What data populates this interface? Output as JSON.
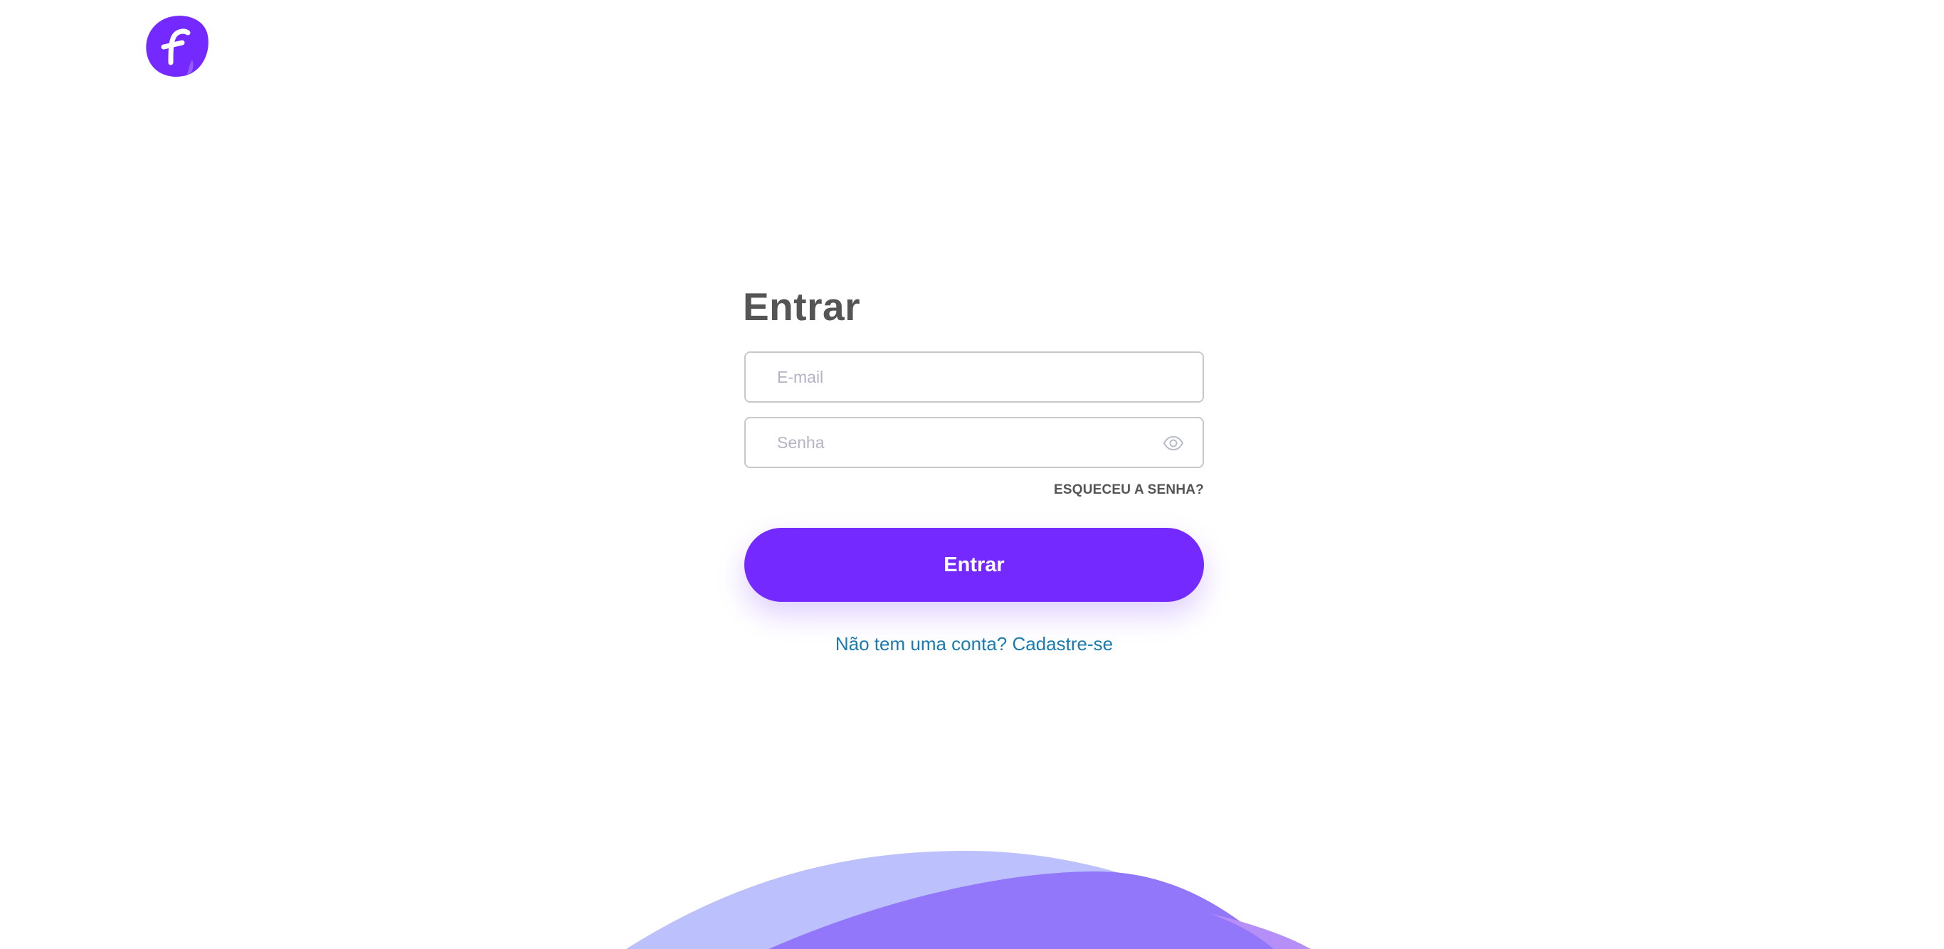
{
  "brand": {
    "logo_icon": "brand-logo-icon",
    "logo_letter": "f",
    "primary_color": "#7329ff"
  },
  "login": {
    "title": "Entrar",
    "email": {
      "placeholder": "E-mail",
      "value": ""
    },
    "password": {
      "placeholder": "Senha",
      "value": "",
      "toggle_icon": "eye-icon"
    },
    "forgot_password_label": "ESQUECEU A SENHA?",
    "submit_label": "Entrar",
    "signup_label": "Não tem uma conta? Cadastre-se"
  },
  "colors": {
    "title": "#555555",
    "link": "#1a7bb0",
    "wave_light": "#bcc0fc",
    "wave_mid": "#9377fa",
    "wave_right": "#b58ef8"
  }
}
